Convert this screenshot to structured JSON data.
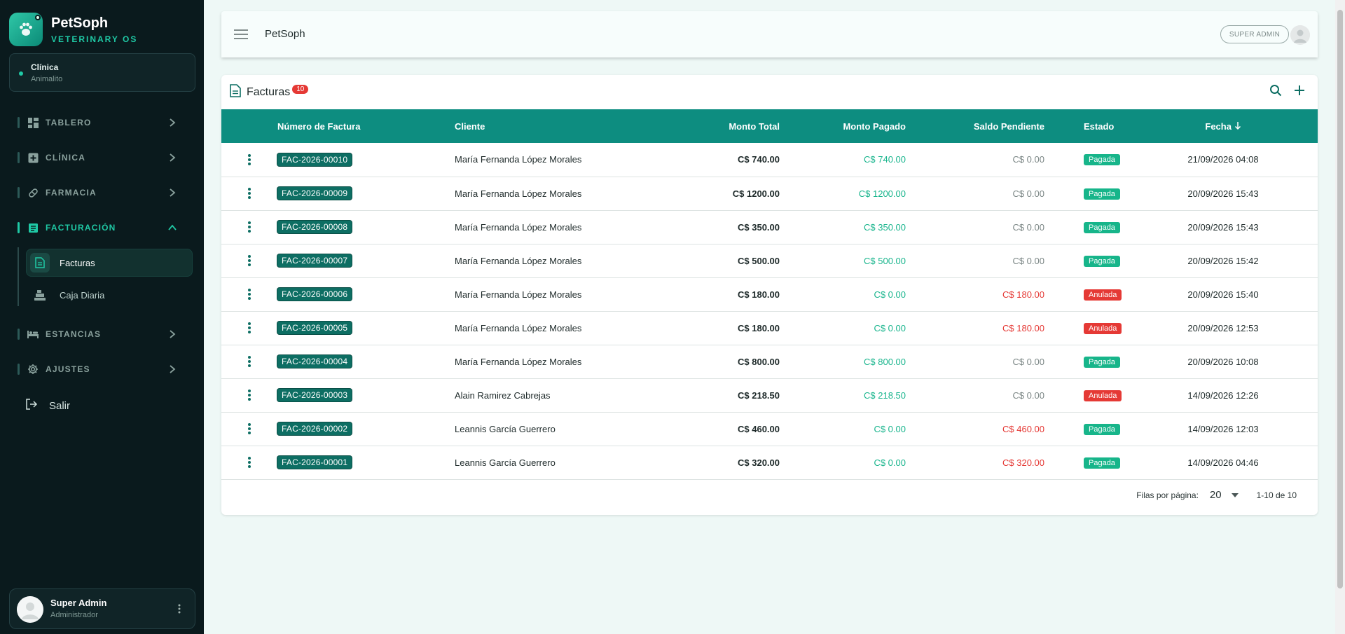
{
  "brand": {
    "name": "PetSoph",
    "subtitle": "VETERINARY OS"
  },
  "clinic": {
    "label": "Clínica",
    "name": "Animalito"
  },
  "nav": [
    {
      "label": "TABLERO",
      "icon": "dashboard-icon",
      "expanded": false
    },
    {
      "label": "CLÍNICA",
      "icon": "medical-cross-icon",
      "expanded": false
    },
    {
      "label": "FARMACIA",
      "icon": "pill-icon",
      "expanded": false
    },
    {
      "label": "FACTURACIÓN",
      "icon": "receipt-icon",
      "expanded": true
    },
    {
      "label": "ESTANCIAS",
      "icon": "bed-icon",
      "expanded": false
    },
    {
      "label": "AJUSTES",
      "icon": "gear-icon",
      "expanded": false
    }
  ],
  "billing_sub": [
    {
      "label": "Facturas",
      "icon": "document-icon",
      "active": true
    },
    {
      "label": "Caja Diaria",
      "icon": "cash-register-icon",
      "active": false
    }
  ],
  "logout_label": "Salir",
  "user": {
    "name": "Super Admin",
    "role": "Administrador"
  },
  "topbar": {
    "title": "PetSoph",
    "role_badge": "SUPER ADMIN"
  },
  "invoices": {
    "title": "Facturas",
    "count": "10",
    "columns": [
      "Número de Factura",
      "Cliente",
      "Monto Total",
      "Monto Pagado",
      "Saldo Pendiente",
      "Estado",
      "Fecha"
    ],
    "sort_column": "Fecha",
    "rows": [
      {
        "number": "FAC-2026-00010",
        "client": "María Fernanda López Morales",
        "total": "C$ 740.00",
        "paid": "C$ 740.00",
        "balance": "C$ 0.00",
        "status": "Pagada",
        "date": "21/09/2026 04:08"
      },
      {
        "number": "FAC-2026-00009",
        "client": "María Fernanda López Morales",
        "total": "C$ 1200.00",
        "paid": "C$ 1200.00",
        "balance": "C$ 0.00",
        "status": "Pagada",
        "date": "20/09/2026 15:43"
      },
      {
        "number": "FAC-2026-00008",
        "client": "María Fernanda López Morales",
        "total": "C$ 350.00",
        "paid": "C$ 350.00",
        "balance": "C$ 0.00",
        "status": "Pagada",
        "date": "20/09/2026 15:43"
      },
      {
        "number": "FAC-2026-00007",
        "client": "María Fernanda López Morales",
        "total": "C$ 500.00",
        "paid": "C$ 500.00",
        "balance": "C$ 0.00",
        "status": "Pagada",
        "date": "20/09/2026 15:42"
      },
      {
        "number": "FAC-2026-00006",
        "client": "María Fernanda López Morales",
        "total": "C$ 180.00",
        "paid": "C$ 0.00",
        "balance": "C$ 180.00",
        "status": "Anulada",
        "date": "20/09/2026 15:40"
      },
      {
        "number": "FAC-2026-00005",
        "client": "María Fernanda López Morales",
        "total": "C$ 180.00",
        "paid": "C$ 0.00",
        "balance": "C$ 180.00",
        "status": "Anulada",
        "date": "20/09/2026 12:53"
      },
      {
        "number": "FAC-2026-00004",
        "client": "María Fernanda López Morales",
        "total": "C$ 800.00",
        "paid": "C$ 800.00",
        "balance": "C$ 0.00",
        "status": "Pagada",
        "date": "20/09/2026 10:08"
      },
      {
        "number": "FAC-2026-00003",
        "client": "Alain Ramirez Cabrejas",
        "total": "C$ 218.50",
        "paid": "C$ 218.50",
        "balance": "C$ 0.00",
        "status": "Anulada",
        "date": "14/09/2026 12:26"
      },
      {
        "number": "FAC-2026-00002",
        "client": "Leannis García Guerrero",
        "total": "C$ 460.00",
        "paid": "C$ 0.00",
        "balance": "C$ 460.00",
        "status": "Pagada",
        "date": "14/09/2026 12:03"
      },
      {
        "number": "FAC-2026-00001",
        "client": "Leannis García Guerrero",
        "total": "C$ 320.00",
        "paid": "C$ 0.00",
        "balance": "C$ 320.00",
        "status": "Pagada",
        "date": "14/09/2026 04:46"
      }
    ]
  },
  "pagination": {
    "rows_label": "Filas por página:",
    "rows_value": "20",
    "range": "1-10 de 10"
  },
  "colors": {
    "accent": "#0d8d80",
    "paid": "#19b58d",
    "danger": "#e53935",
    "sidebar": "#0a1a1d"
  }
}
